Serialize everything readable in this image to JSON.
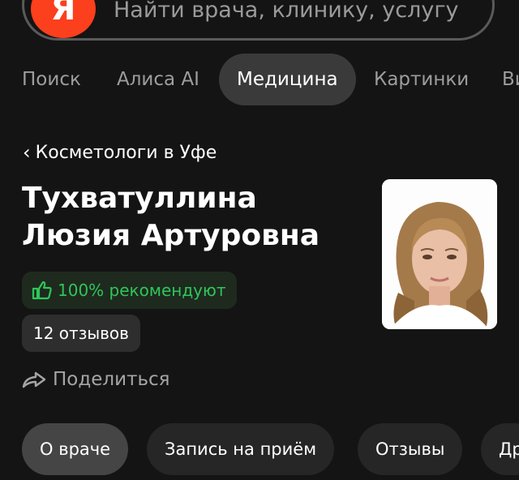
{
  "search": {
    "logo_letter": "Я",
    "placeholder": "Найти врача, клинику, услугу"
  },
  "tabs": [
    {
      "label": "Поиск"
    },
    {
      "label": "Алиса AI"
    },
    {
      "label": "Медицина",
      "active": true
    },
    {
      "label": "Картинки"
    },
    {
      "label": "Ви"
    }
  ],
  "breadcrumb": {
    "chevron": "‹",
    "label": "Косметологи в Уфе"
  },
  "doctor": {
    "name_line1": "Тухватуллина",
    "name_line2": "Люзия Артуровна",
    "recommend": "100% рекомендуют",
    "reviews": "12 отзывов",
    "share": "Поделиться"
  },
  "section_tabs": [
    {
      "label": "О враче",
      "active": true
    },
    {
      "label": "Запись на приём"
    },
    {
      "label": "Отзывы"
    },
    {
      "label": "Др"
    }
  ],
  "colors": {
    "background": "#141414",
    "logo": "#fc3f1d",
    "recommend_green": "#2fc55a"
  }
}
